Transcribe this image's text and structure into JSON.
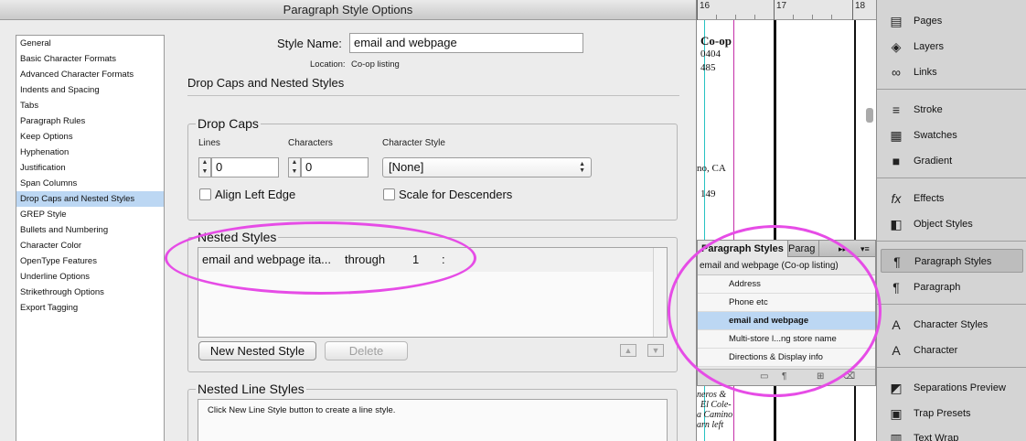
{
  "dialog": {
    "title": "Paragraph Style Options",
    "style_name_label": "Style Name:",
    "style_name_value": "email and webpage",
    "location_label": "Location:",
    "location_value": "Co-op listing",
    "section_title": "Drop Caps and Nested Styles"
  },
  "categories": [
    {
      "label": "General"
    },
    {
      "label": "Basic Character Formats"
    },
    {
      "label": "Advanced Character Formats"
    },
    {
      "label": "Indents and Spacing"
    },
    {
      "label": "Tabs"
    },
    {
      "label": "Paragraph Rules"
    },
    {
      "label": "Keep Options"
    },
    {
      "label": "Hyphenation"
    },
    {
      "label": "Justification"
    },
    {
      "label": "Span Columns"
    },
    {
      "label": "Drop Caps and Nested Styles",
      "selected": true
    },
    {
      "label": "GREP Style"
    },
    {
      "label": "Bullets and Numbering"
    },
    {
      "label": "Character Color"
    },
    {
      "label": "OpenType Features"
    },
    {
      "label": "Underline Options"
    },
    {
      "label": "Strikethrough Options"
    },
    {
      "label": "Export Tagging"
    }
  ],
  "drop_caps": {
    "title": "Drop Caps",
    "lines_label": "Lines",
    "lines_value": "0",
    "characters_label": "Characters",
    "characters_value": "0",
    "char_style_label": "Character Style",
    "char_style_value": "[None]",
    "align_left_edge_label": "Align Left Edge",
    "scale_descenders_label": "Scale for Descenders"
  },
  "nested_styles": {
    "title": "Nested Styles",
    "rows": [
      {
        "style": "email and webpage ita...",
        "mode": "through",
        "count": "1",
        "delimiter": ":"
      }
    ],
    "new_button": "New Nested Style",
    "delete_button": "Delete"
  },
  "nested_line_styles": {
    "title": "Nested Line Styles",
    "hint": "Click New Line Style button to create a line style."
  },
  "document": {
    "ruler_labels": [
      "16",
      "17",
      "18"
    ],
    "text_lines": [
      "Co-op",
      "0404",
      "485",
      "no, CA",
      "149",
      "neros &",
      "El Cole-",
      "a Camino",
      "arn left"
    ]
  },
  "paragraph_styles_panel": {
    "tab_active": "Paragraph Styles",
    "tab_inactive": "Parag",
    "current_style": "email and webpage (Co-op listing)",
    "items": [
      {
        "label": "Address"
      },
      {
        "label": "Phone etc"
      },
      {
        "label": "email and webpage",
        "selected": true
      },
      {
        "label": "Multi-store l...ng store name"
      },
      {
        "label": "Directions & Display info"
      }
    ]
  },
  "dock": {
    "groups": [
      [
        {
          "label": "Pages",
          "icon": "pages-icon"
        },
        {
          "label": "Layers",
          "icon": "layers-icon"
        },
        {
          "label": "Links",
          "icon": "links-icon"
        }
      ],
      [
        {
          "label": "Stroke",
          "icon": "stroke-icon"
        },
        {
          "label": "Swatches",
          "icon": "swatches-icon"
        },
        {
          "label": "Gradient",
          "icon": "gradient-icon"
        }
      ],
      [
        {
          "label": "Effects",
          "icon": "effects-icon"
        },
        {
          "label": "Object Styles",
          "icon": "object-styles-icon"
        }
      ],
      [
        {
          "label": "Paragraph Styles",
          "icon": "paragraph-styles-icon",
          "active": true
        },
        {
          "label": "Paragraph",
          "icon": "paragraph-icon"
        }
      ],
      [
        {
          "label": "Character Styles",
          "icon": "character-styles-icon"
        },
        {
          "label": "Character",
          "icon": "character-icon"
        }
      ],
      [
        {
          "label": "Separations Preview",
          "icon": "separations-icon"
        },
        {
          "label": "Trap Presets",
          "icon": "trap-presets-icon"
        },
        {
          "label": "Text Wrap",
          "icon": "text-wrap-icon"
        }
      ]
    ]
  },
  "colors": {
    "selection": "#bcd7f3",
    "annotation": "#e64ce6"
  }
}
